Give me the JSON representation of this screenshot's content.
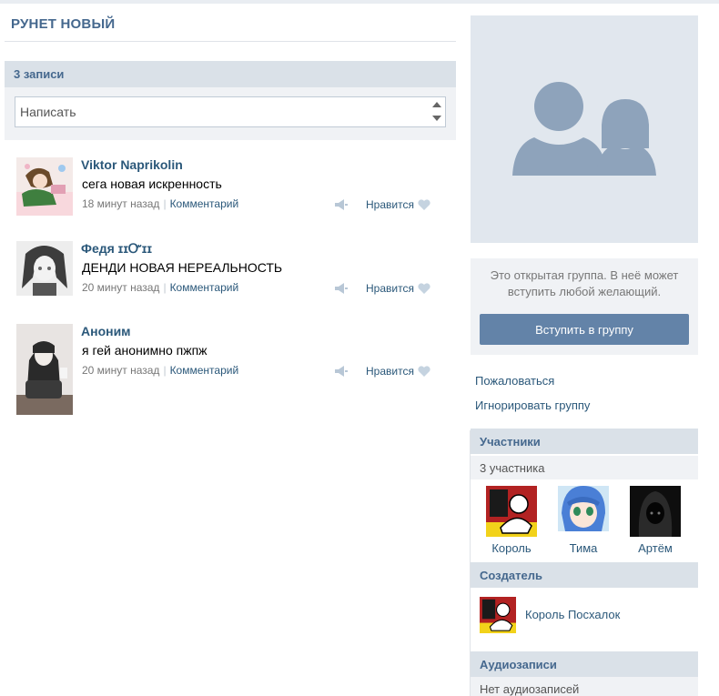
{
  "group": {
    "title": "РУНЕТ НОВЫЙ"
  },
  "wall": {
    "count_label": "3 записи",
    "compose_placeholder": "Написать",
    "posts": [
      {
        "author": "Viktor Naprikolin",
        "text": "сега новая искренность",
        "time": "18 минут назад",
        "comment_label": "Комментарий",
        "like_label": "Нравится"
      },
      {
        "author": "Федя ɪɪᏅɪɪ",
        "text": "ДЕНДИ НОВАЯ НЕРЕАЛЬНОСТЬ",
        "time": "20 минут назад",
        "comment_label": "Комментарий",
        "like_label": "Нравится"
      },
      {
        "author": "Аноним",
        "text": "я гей анонимно пжпж",
        "time": "20 минут назад",
        "comment_label": "Комментарий",
        "like_label": "Нравится"
      }
    ]
  },
  "sidebar": {
    "open_text": "Это открытая группа. В неё может вступить любой желающий.",
    "join_label": "Вступить в группу",
    "report_label": "Пожаловаться",
    "ignore_label": "Игнорировать группу",
    "members": {
      "header": "Участники",
      "count": "3 участника",
      "list": [
        {
          "name": "Король"
        },
        {
          "name": "Тима"
        },
        {
          "name": "Артём"
        }
      ]
    },
    "creator": {
      "header": "Создатель",
      "name": "Король Посхалок"
    },
    "audio": {
      "header": "Аудиозаписи",
      "empty": "Нет аудиозаписей"
    }
  },
  "colors": {
    "accent": "#45688e",
    "link": "#2b587a",
    "header_bg": "#dae1e8",
    "button_bg": "#6383a8",
    "panel_bg": "#f0f2f5"
  }
}
